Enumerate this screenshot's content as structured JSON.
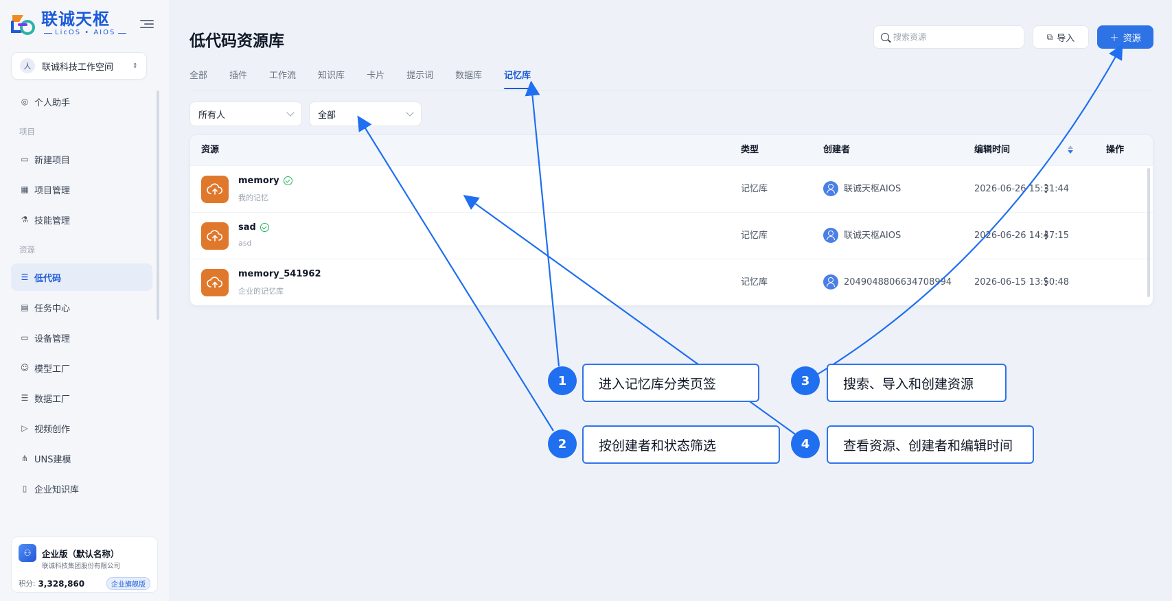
{
  "brand": {
    "title": "联诚天枢",
    "subtitle": "LicOS • AIOS"
  },
  "workspace": {
    "avatar": "人",
    "name": "联诚科技工作空间"
  },
  "sidebar": {
    "items": [
      {
        "label": "个人助手",
        "icon": "chat-icon",
        "glyph": "◎"
      },
      {
        "section": "项目"
      },
      {
        "label": "新建项目",
        "icon": "monitor-icon",
        "glyph": "▭"
      },
      {
        "label": "项目管理",
        "icon": "grid-icon",
        "glyph": "▦"
      },
      {
        "label": "技能管理",
        "icon": "flask-icon",
        "glyph": "⚗"
      },
      {
        "section": "资源"
      },
      {
        "label": "低代码",
        "icon": "list-icon",
        "glyph": "☰",
        "active": true
      },
      {
        "label": "任务中心",
        "icon": "calendar-icon",
        "glyph": "▤"
      },
      {
        "label": "设备管理",
        "icon": "laptop-icon",
        "glyph": "▭"
      },
      {
        "label": "模型工厂",
        "icon": "robot-icon",
        "glyph": "☺"
      },
      {
        "label": "数据工厂",
        "icon": "database-icon",
        "glyph": "☰"
      },
      {
        "label": "视频创作",
        "icon": "video-icon",
        "glyph": "▷"
      },
      {
        "label": "UNS建模",
        "icon": "network-icon",
        "glyph": "⋔"
      },
      {
        "label": "企业知识库",
        "icon": "book-icon",
        "glyph": "▯"
      }
    ]
  },
  "plan": {
    "name": "企业版（默认名称）",
    "org": "联诚科技集团股份有限公司",
    "points_label": "积分:",
    "points": "3,328,860",
    "badge": "企业旗舰版"
  },
  "header": {
    "title": "低代码资源库",
    "search_placeholder": "搜索资源",
    "import_label": "导入",
    "create_label": "资源"
  },
  "tabs": [
    "全部",
    "插件",
    "工作流",
    "知识库",
    "卡片",
    "提示词",
    "数据库",
    "记忆库"
  ],
  "active_tab": 7,
  "filters": {
    "owner": "所有人",
    "status": "全部"
  },
  "table": {
    "columns": [
      "资源",
      "类型",
      "创建者",
      "编辑时间",
      "操作"
    ],
    "rows": [
      {
        "name": "memory",
        "desc": "我的记忆",
        "type": "记忆库",
        "creator": "联诚天枢AIOS",
        "time": "2026-06-26 15:31:44",
        "verified": true
      },
      {
        "name": "sad",
        "desc": "asd",
        "type": "记忆库",
        "creator": "联诚天枢AIOS",
        "time": "2026-06-26 14:47:15",
        "verified": true
      },
      {
        "name": "memory_541962",
        "desc": "企业的记忆库",
        "type": "记忆库",
        "creator": "2049048806634708994",
        "time": "2026-06-15 13:50:48",
        "verified": false
      }
    ]
  },
  "annotations": {
    "colors": {
      "arrow": "#1f6ff0",
      "border": "#2f74ec"
    },
    "items": [
      {
        "num": "1",
        "text": "进入记忆库分类页签"
      },
      {
        "num": "2",
        "text": "按创建者和状态筛选"
      },
      {
        "num": "3",
        "text": "搜索、导入和创建资源"
      },
      {
        "num": "4",
        "text": "查看资源、创建者和编辑时间"
      }
    ]
  }
}
